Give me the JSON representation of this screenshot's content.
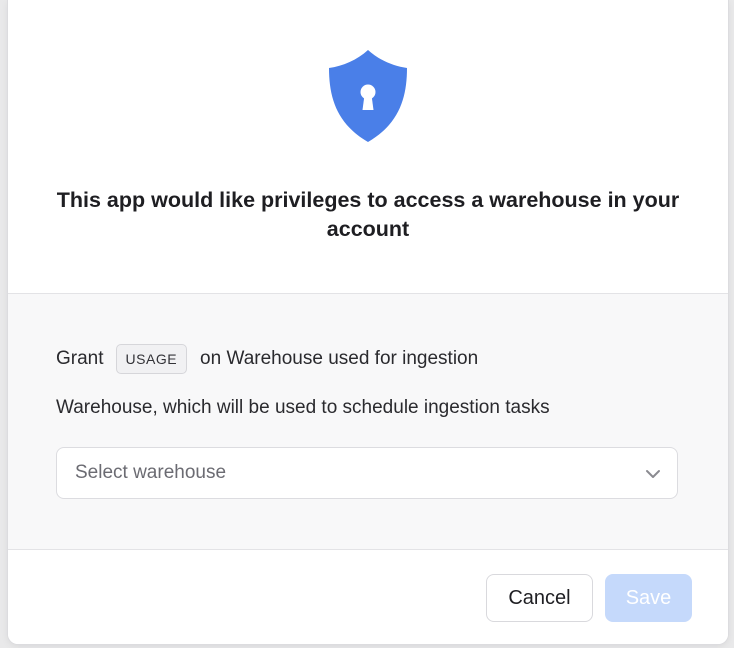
{
  "dialog": {
    "icon": "shield-lock-icon",
    "title": "This app would like privileges to access a warehouse in your account"
  },
  "grant": {
    "prefix": "Grant",
    "privilege": "USAGE",
    "suffix": "on Warehouse used for ingestion"
  },
  "warehouse": {
    "description": "Warehouse, which will be used to schedule ingestion tasks",
    "placeholder": "Select warehouse",
    "dropdown_icon": "chevron-down-icon"
  },
  "footer": {
    "cancel_label": "Cancel",
    "save_label": "Save"
  },
  "colors": {
    "accent": "#4a7fe8",
    "save_disabled_bg": "#c5d9fb",
    "body_bg": "#f8f8f9"
  }
}
